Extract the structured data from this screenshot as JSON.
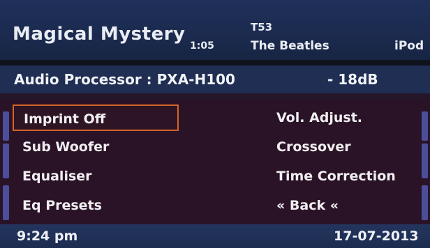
{
  "header": {
    "title": "Magical Mystery",
    "elapsed": "1:05",
    "track": "T53",
    "artist": "The Beatles",
    "source": "iPod"
  },
  "processor": {
    "label": "Audio Processor : PXA-H100",
    "level": "- 18dB"
  },
  "menu": {
    "left": [
      "Imprint Off",
      "Sub Woofer",
      "Equaliser",
      "Eq Presets"
    ],
    "right": [
      "Vol. Adjust.",
      "Crossover",
      "Time Correction",
      "« Back «"
    ],
    "selected": "Imprint Off"
  },
  "footer": {
    "time": "9:24 pm",
    "date": "17-07-2013"
  },
  "colors": {
    "header_bg": "#1b2a4e",
    "menu_bg": "#2a1326",
    "selection_border": "#d4632a",
    "bracket": "#4b4f9a"
  }
}
